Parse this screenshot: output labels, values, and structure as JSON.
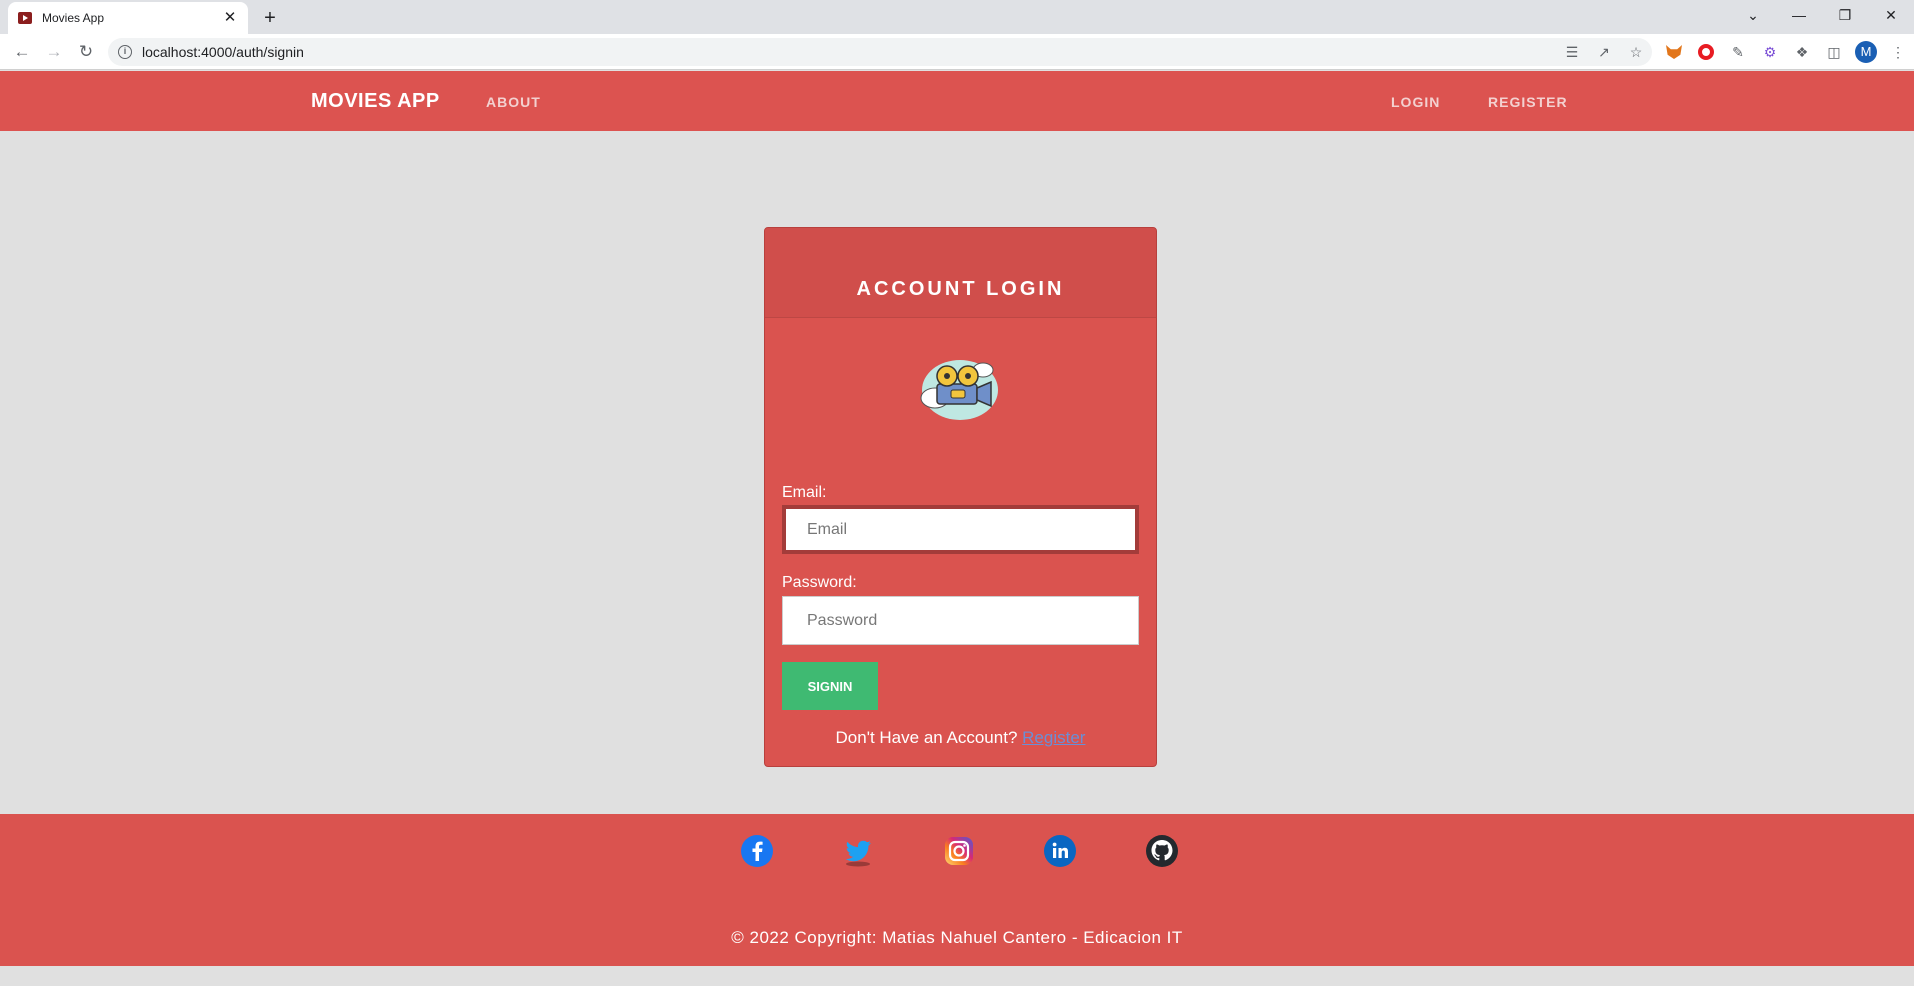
{
  "browser": {
    "tab_title": "Movies App",
    "tab_close": "✕",
    "new_tab": "+",
    "url": "localhost:4000/auth/signin",
    "profile_initial": "M",
    "window_controls": [
      "⌄",
      "—",
      "❐",
      "✕"
    ]
  },
  "navbar": {
    "brand": "MOVIES APP",
    "about": "ABOUT",
    "login": "LOGIN",
    "register": "REGISTER"
  },
  "login_card": {
    "title": "ACCOUNT LOGIN",
    "email_label": "Email:",
    "email_placeholder": "Email",
    "password_label": "Password:",
    "password_placeholder": "Password",
    "signin_label": "SIGNIN",
    "no_account_text": "Don't Have an Account?",
    "register_link": "Register"
  },
  "footer": {
    "social_icons": [
      "facebook-icon",
      "twitter-icon",
      "instagram-icon",
      "linkedin-icon",
      "github-icon"
    ],
    "copyright": "© 2022 Copyright: Matias Nahuel Cantero - Edicacion IT"
  },
  "colors": {
    "primary": "#dc5350",
    "card": "#da534f",
    "success": "#3fba72",
    "background": "#e0e0e0"
  }
}
